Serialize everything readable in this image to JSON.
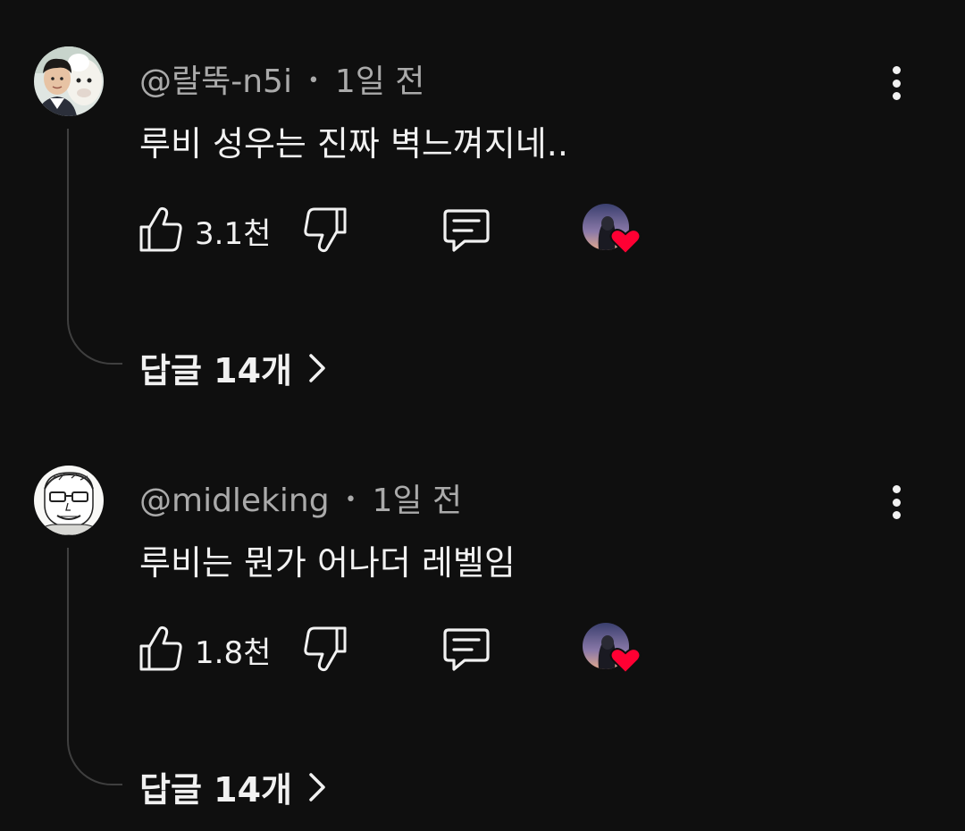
{
  "comments": [
    {
      "author": "@랄뚝-n5i",
      "separator": "•",
      "time": "1일 전",
      "text": "루비 성우는 진짜 벽느껴지네..",
      "likes": "3.1천",
      "replies": "답글 14개",
      "avatar_icon": "profile-photo-man-with-alpaca",
      "creator_heart": true
    },
    {
      "author": "@midleking",
      "separator": "•",
      "time": "1일 전",
      "text": "루비는 뭔가 어나더 레벨임",
      "likes": "1.8천",
      "replies": "답글 14개",
      "avatar_icon": "profile-sketch-man-with-glasses",
      "creator_heart": true
    }
  ],
  "icons": {
    "like": "thumbs-up-icon",
    "dislike": "thumbs-down-icon",
    "reply": "comment-icon",
    "more": "more-vertical-icon",
    "heart": "heart-icon",
    "chevron": "chevron-right-icon"
  },
  "colors": {
    "background": "#0f0f0f",
    "text": "#f1f1f1",
    "meta": "#aaaaaa",
    "heart": "#ff0033",
    "thread_line": "#3f3f3f"
  }
}
